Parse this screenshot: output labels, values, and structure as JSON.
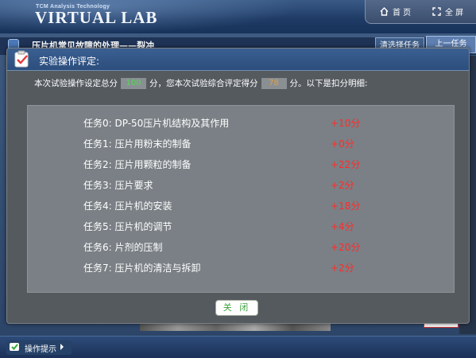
{
  "header": {
    "brand_small": "TCM Analysis Technology",
    "brand": "VIRTUAL LAB",
    "nav": {
      "home_label": "首 页",
      "fullscreen_label": "全 屏",
      "home_icon": "home-icon",
      "fullscreen_icon": "fullscreen-icon"
    }
  },
  "background_page": {
    "title": "压片机常见故障的处理——裂冲",
    "btn_left": "清选择任务",
    "btn_right": "上一任务"
  },
  "dialog": {
    "title": "实验操作评定:",
    "summary": {
      "prefix": "本次试验操作设定总分",
      "total": "100",
      "middle": "分，您本次试验综合评定得分",
      "got": "78",
      "suffix": "分。以下是扣分明细:"
    },
    "tasks": [
      {
        "name": "任务0: DP-50压片机结构及其作用",
        "score": "+10分"
      },
      {
        "name": "任务1: 压片用粉末的制备",
        "score": "+0分"
      },
      {
        "name": "任务2: 压片用颗粒的制备",
        "score": "+22分"
      },
      {
        "name": "任务3: 压片要求",
        "score": "+2分"
      },
      {
        "name": "任务4: 压片机的安装",
        "score": "+18分"
      },
      {
        "name": "任务5: 压片机的调节",
        "score": "+4分"
      },
      {
        "name": "任务6: 片剂的压制",
        "score": "+20分"
      },
      {
        "name": "任务7: 压片机的清洁与拆卸",
        "score": "+2分"
      }
    ],
    "close_label": "关 闭"
  },
  "bottom_bar": {
    "tip_label": "操作提示"
  },
  "colors": {
    "score_text": "#ff2b2b",
    "total_score": "#55d655",
    "got_score": "#e0a040",
    "close_text": "#3da23d"
  }
}
